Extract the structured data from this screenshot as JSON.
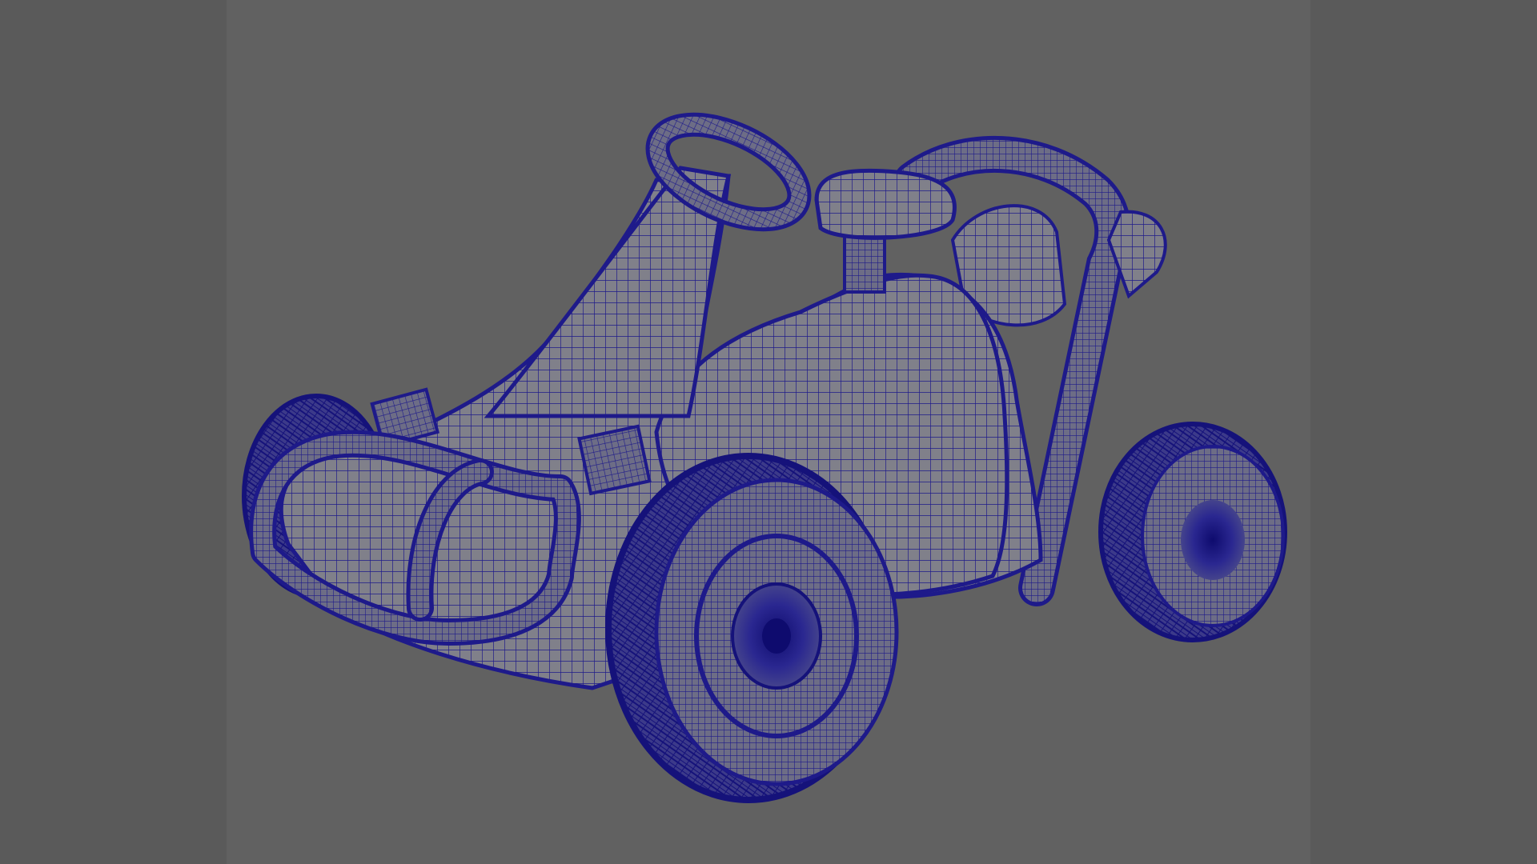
{
  "viewport": {
    "background_color": "#616161",
    "side_band_color": "#5a5a5a",
    "display_mode": "wireframe-on-shaded"
  },
  "model": {
    "subject": "go-kart",
    "wire_color": "#1e1a8a",
    "surface_color": "#7a7a84",
    "parts": [
      "steering-wheel",
      "steering-column",
      "seat",
      "headrest",
      "roll-bar",
      "front-bumper",
      "pedals",
      "front-left-wheel",
      "front-right-wheel",
      "rear-wheel",
      "engine"
    ]
  }
}
